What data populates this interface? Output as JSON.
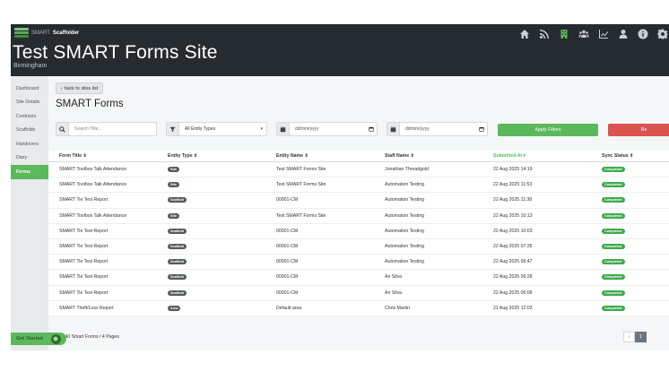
{
  "brand": {
    "prefix": "SMART",
    "name": "Scaffolder"
  },
  "site": {
    "title": "Test SMART Forms Site",
    "subtitle": "Birmingham"
  },
  "nav_icons": [
    "home-icon",
    "rss-icon",
    "building-icon",
    "team-icon",
    "chart-icon",
    "user-icon",
    "info-icon",
    "gear-icon"
  ],
  "sidebar": {
    "items": [
      {
        "label": "Dashboard"
      },
      {
        "label": "Site Details"
      },
      {
        "label": "Contracts"
      },
      {
        "label": "Scaffolds"
      },
      {
        "label": "Handovers"
      },
      {
        "label": "Diary"
      },
      {
        "label": "Forms"
      }
    ]
  },
  "main": {
    "back_label": "back to sites list",
    "page_title": "SMART Forms",
    "filters": {
      "search_placeholder": "Search Title...",
      "entity_type": "All Entity Types",
      "date_from_placeholder": "dd/mm/yyyy",
      "date_to_placeholder": "dd/mm/yyyy",
      "apply_label": "Apply Filters",
      "reset_label": "Re"
    }
  },
  "table": {
    "headers": [
      "Form Title",
      "Entity Type",
      "Entity Name",
      "Staff Name",
      "Submitted At",
      "Sync Status"
    ],
    "rows": [
      {
        "title": "SMART Toolbox Talk Attendance",
        "entity_type": "Site",
        "entity_name": "Test SMART Forms Site",
        "staff": "Jonathan Threadgold",
        "submitted": "22 Aug 2025 14:19",
        "status": "Completed"
      },
      {
        "title": "SMART Toolbox Talk Attendance",
        "entity_type": "Site",
        "entity_name": "Test SMART Forms Site",
        "staff": "Automation Testing",
        "submitted": "22 Aug 2025 11:53",
        "status": "Completed"
      },
      {
        "title": "SMART Tie Test Report",
        "entity_type": "Scaffold",
        "entity_name": "00001-CM",
        "staff": "Automation Testing",
        "submitted": "22 Aug 2025 11:38",
        "status": "Completed"
      },
      {
        "title": "SMART Toolbox Talk Attendance",
        "entity_type": "Site",
        "entity_name": "Test SMART Forms Site",
        "staff": "Automation Testing",
        "submitted": "22 Aug 2025 10:13",
        "status": "Completed"
      },
      {
        "title": "SMART Tie Test Report",
        "entity_type": "Scaffold",
        "entity_name": "00001-CM",
        "staff": "Automation Testing",
        "submitted": "22 Aug 2025 10:03",
        "status": "Completed"
      },
      {
        "title": "SMART Tie Test Report",
        "entity_type": "Scaffold",
        "entity_name": "00001-CM",
        "staff": "Automation Testing",
        "submitted": "22 Aug 2025 07:35",
        "status": "Completed"
      },
      {
        "title": "SMART Tie Test Report",
        "entity_type": "Scaffold",
        "entity_name": "00001-CM",
        "staff": "Automation Testing",
        "submitted": "22 Aug 2025 06:47",
        "status": "Completed"
      },
      {
        "title": "SMART Tie Test Report",
        "entity_type": "Scaffold",
        "entity_name": "00001-CM",
        "staff": "Ari Silva",
        "submitted": "22 Aug 2025 06:28",
        "status": "Completed"
      },
      {
        "title": "SMART Tie Test Report",
        "entity_type": "Scaffold",
        "entity_name": "00001-CM",
        "staff": "Ari Silva",
        "submitted": "22 Aug 2025 06:06",
        "status": "Completed"
      },
      {
        "title": "SMART Theft/Loss Report",
        "entity_type": "Area",
        "entity_name": "Default area",
        "staff": "Chris Martin",
        "submitted": "21 Aug 2025 12:03",
        "status": "Completed"
      }
    ]
  },
  "footer": {
    "total": "tal: 40 Smart Forms / 4 Pages",
    "prev": "‹",
    "page": "1"
  },
  "get_started": {
    "label": "Get Started"
  },
  "colors": {
    "accent": "#5cb85c",
    "header_bg": "#262b30",
    "danger": "#d9534f"
  }
}
